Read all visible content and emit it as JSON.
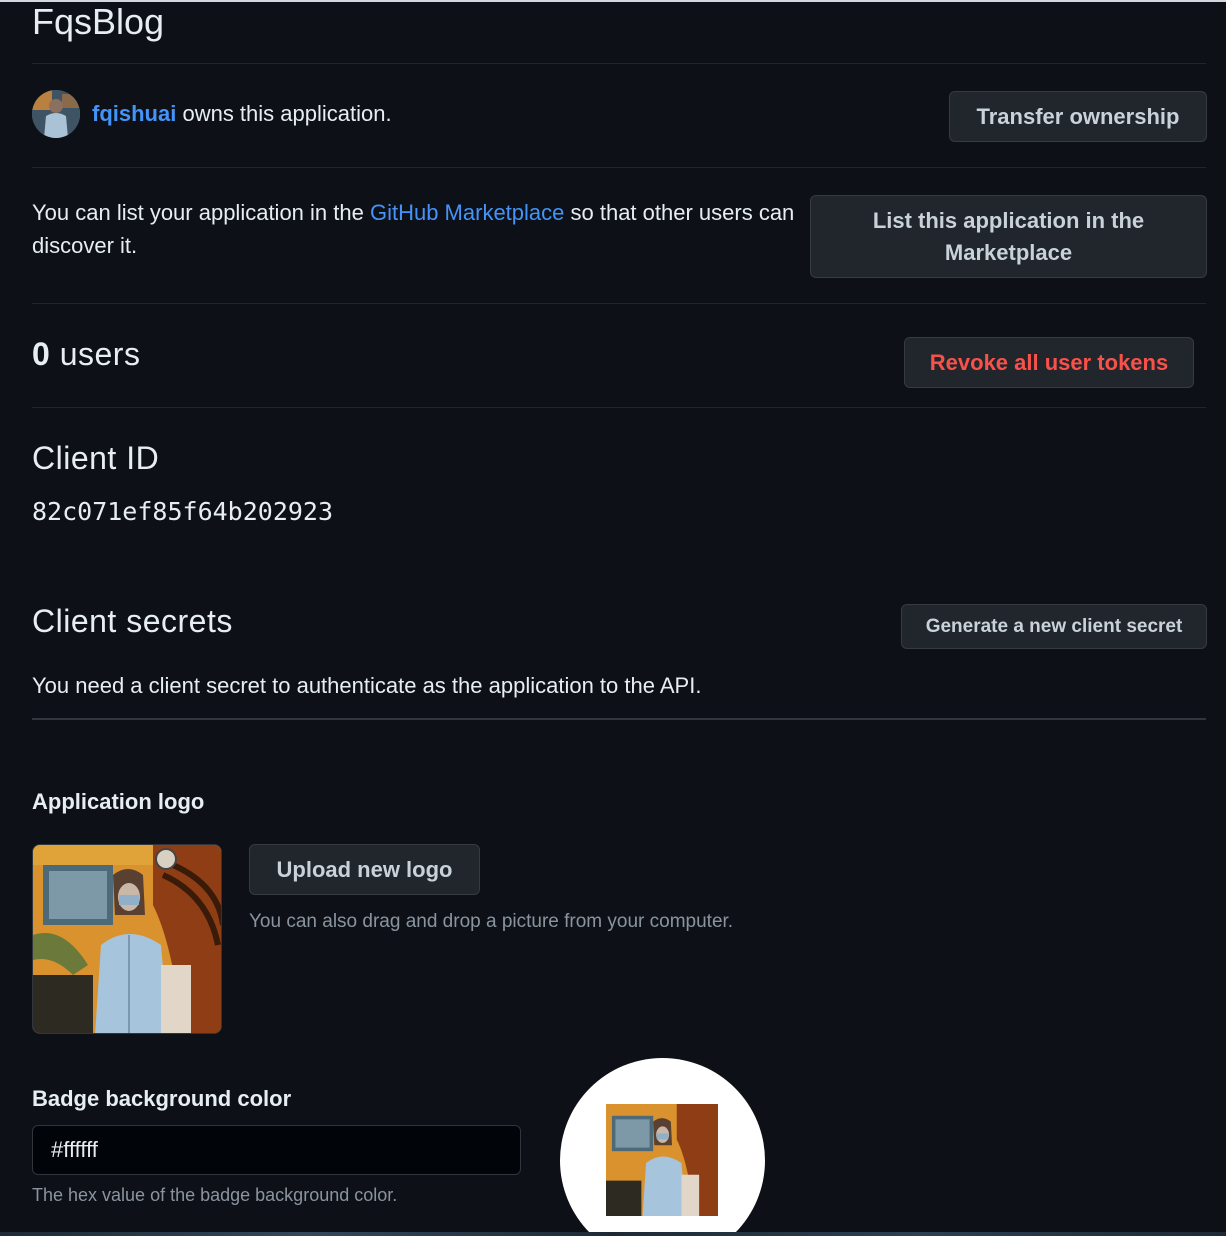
{
  "app": {
    "title": "FqsBlog"
  },
  "owner": {
    "username": "fqishuai",
    "text": " owns this application.",
    "transfer_label": "Transfer ownership"
  },
  "marketplace": {
    "text_before": "You can list your application in the ",
    "link_text": "GitHub Marketplace",
    "text_after": " so that other users can discover it.",
    "button_label": "List this application in the Marketplace"
  },
  "users": {
    "count": "0",
    "label": " users",
    "revoke_label": "Revoke all user tokens"
  },
  "client_id": {
    "heading": "Client ID",
    "value": "82c071ef85f64b202923"
  },
  "client_secrets": {
    "heading": "Client secrets",
    "generate_label": "Generate a new client secret",
    "description": "You need a client secret to authenticate as the application to the API."
  },
  "logo": {
    "heading": "Application logo",
    "upload_label": "Upload new logo",
    "hint": "You can also drag and drop a picture from your computer."
  },
  "badge": {
    "heading": "Badge background color",
    "value": "#ffffff",
    "hint": "The hex value of the badge background color."
  },
  "colors": {
    "background": "#0d1117",
    "link": "#4493f8",
    "danger": "#f85149",
    "button_bg": "#21262d"
  }
}
